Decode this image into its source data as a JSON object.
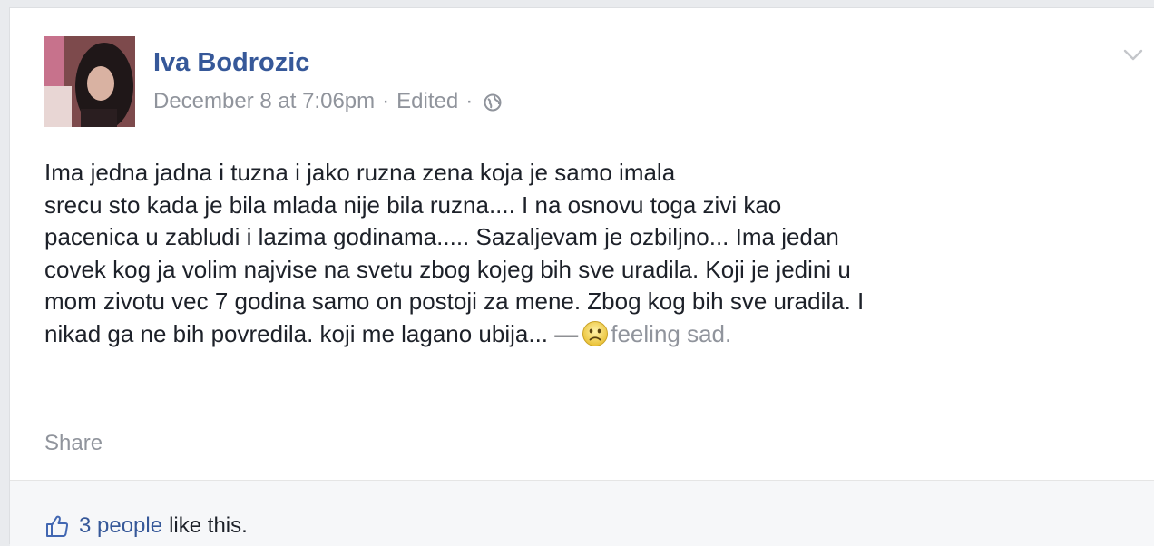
{
  "post": {
    "author": "Iva Bodrozic",
    "timestamp": "December 8 at 7:06pm",
    "separator": "·",
    "edited": "Edited",
    "audience_icon": "globe-icon",
    "options_icon": "chevron-down-icon",
    "text_lines": [
      "Ima jedna jadna i tuzna i jako ruzna zena koja je samo imala",
      "srecu sto kada je bila mlada nije bila ruzna.... I na osnovu toga zivi kao",
      "pacenica u zabludi i lazima godinama..... Sazaljevam je ozbiljno... Ima jedan",
      "covek kog ja volim najvise na svetu zbog kojeg bih sve uradila. Koji je jedini u",
      "mom zivotu vec 7 godina samo on postoji za mene. Zbog kog bih sve uradila. I",
      "nikad ga ne bih povredila. koji me lagano ubija... —"
    ],
    "feeling_icon": "sad-face-icon",
    "feeling_text": "feeling sad.",
    "share_label": "Share"
  },
  "footer": {
    "like_icon": "thumbs-up-icon",
    "like_count": "3 people",
    "like_suffix": "like this."
  },
  "colors": {
    "link": "#365899",
    "meta": "#90949c",
    "text": "#1d2129",
    "page_bg": "#e9ebee",
    "footer_bg": "#f6f7f9"
  }
}
